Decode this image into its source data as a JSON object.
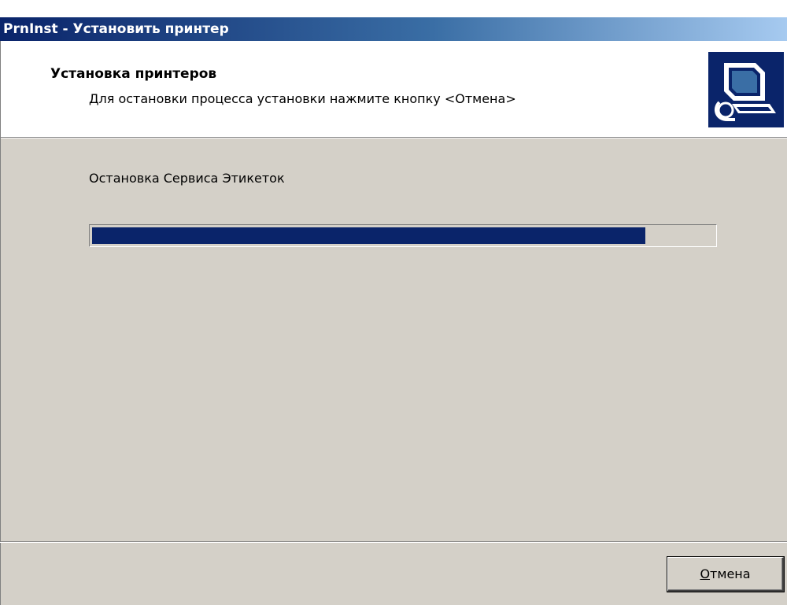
{
  "window": {
    "title": "PrnInst - Установить принтер"
  },
  "header": {
    "title": "Установка принтеров",
    "subtitle": "Для остановки процесса установки нажмите кнопку <Отмена>",
    "icon": "computer-install-icon"
  },
  "main": {
    "status": "Остановка Сервиса Этикеток",
    "progress": 0.89
  },
  "footer": {
    "cancel_accel": "О",
    "cancel_rest": "тмена"
  },
  "colors": {
    "titlebar_start": "#0a246a",
    "titlebar_end": "#a6caf0",
    "progress_fill": "#0a246a",
    "dialog_face": "#d4d0c8"
  }
}
